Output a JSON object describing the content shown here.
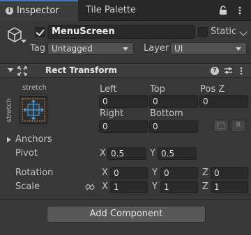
{
  "tabs": [
    {
      "label": "Inspector",
      "active": true
    },
    {
      "label": "Tile Palette",
      "active": false
    }
  ],
  "object": {
    "active": true,
    "name": "MenuScreen",
    "static_label": "Static",
    "static": false,
    "tag_label": "Tag",
    "tag_value": "Untagged",
    "layer_label": "Layer",
    "layer_value": "UI"
  },
  "rect_transform": {
    "title": "Rect Transform",
    "anchor_label_top": "stretch",
    "anchor_label_side": "stretch",
    "fields_row1": {
      "left_label": "Left",
      "left": "0",
      "top_label": "Top",
      "top": "0",
      "posz_label": "Pos Z",
      "posz": "0"
    },
    "fields_row2": {
      "right_label": "Right",
      "right": "0",
      "bottom_label": "Bottom",
      "bottom": "0"
    },
    "raw_button": "R",
    "anchors_label": "Anchors",
    "pivot": {
      "label": "Pivot",
      "x_label": "X",
      "x": "0.5",
      "y_label": "Y",
      "y": "0.5"
    },
    "rotation": {
      "label": "Rotation",
      "x_label": "X",
      "x": "0",
      "y_label": "Y",
      "y": "0",
      "z_label": "Z",
      "z": "0"
    },
    "scale": {
      "label": "Scale",
      "x_label": "X",
      "x": "1",
      "y_label": "Y",
      "y": "1",
      "z_label": "Z",
      "z": "1"
    }
  },
  "add_component": "Add Component",
  "colors": {
    "accent": "#3a79bb",
    "anchor_blue": "#5aa9e6",
    "anchor_orange": "#d98a3a"
  }
}
